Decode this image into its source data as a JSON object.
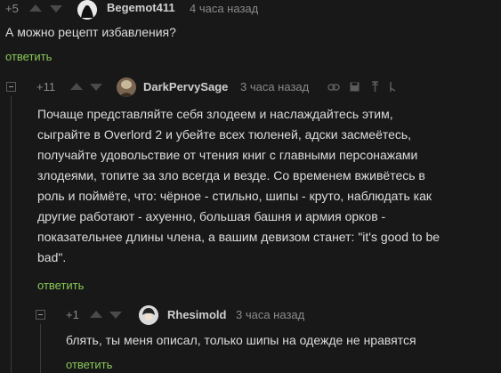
{
  "comments": [
    {
      "rating": "+5",
      "username": "Begemot411",
      "time": "4 часа назад",
      "text": "А можно рецепт избавления?",
      "reply_label": "ответить"
    },
    {
      "rating": "+11",
      "username": "DarkPervySage",
      "time": "3 часа назад",
      "text_lines": [
        "Почаще представляйте себя злодеем и наслаждайтесь этим,",
        "сыграйте в Overlord 2 и убейте всех тюленей, адски засмеётесь,",
        "получайте удовольствие от чтения книг с главными персонажами",
        "злодеями, топите за зло всегда и везде. Со временем вживётесь в",
        "роль и поймёте, что: чёрное - стильно, шипы - круто, наблюдать как",
        "другие работают - ахуенно, большая башня и армия орков -",
        "показательнее длины члена, а вашим девизом станет: \"it's good to be",
        "bad\"."
      ],
      "reply_label": "ответить",
      "toolbar_icons": [
        "link-icon",
        "save-icon",
        "pin-icon",
        "more-icon"
      ]
    },
    {
      "rating": "+1",
      "username": "Rhesimold",
      "time": "3 часа назад",
      "text": "блять, ты меня описал, только шипы на одежде не нравятся",
      "reply_label": "ответить"
    }
  ]
}
